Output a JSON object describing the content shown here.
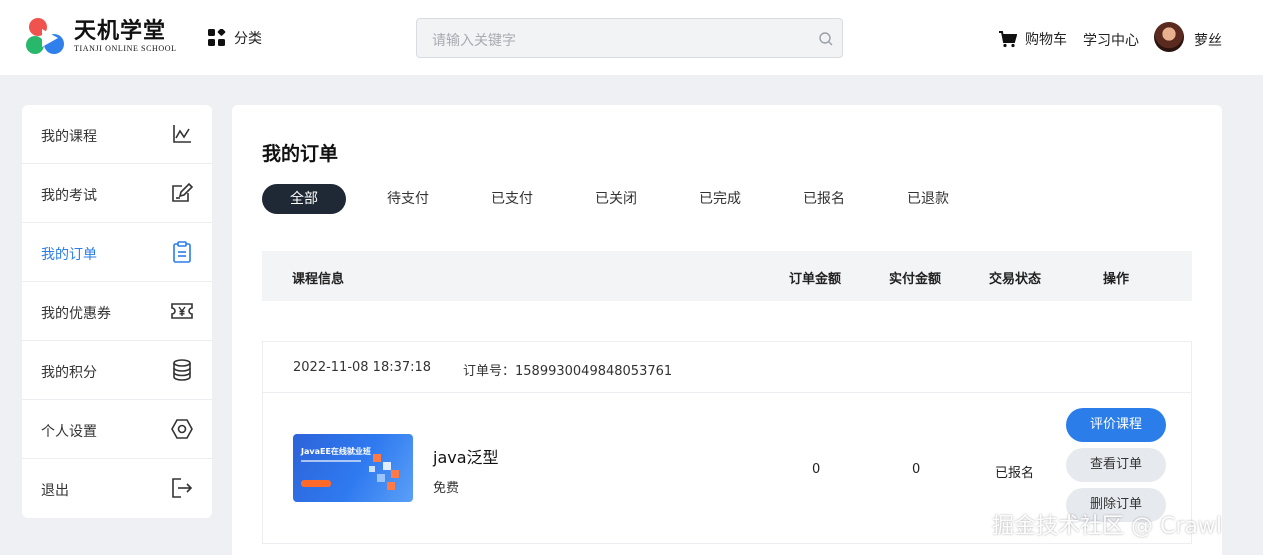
{
  "header": {
    "logo_cn": "天机学堂",
    "logo_en": "TIANJI ONLINE SCHOOL",
    "category_label": "分类",
    "search_placeholder": "请输入关键字",
    "cart_label": "购物车",
    "learning_center_label": "学习中心",
    "username": "萝丝"
  },
  "sidebar": {
    "items": [
      {
        "label": "我的课程",
        "icon": "chart-icon",
        "active": false
      },
      {
        "label": "我的考试",
        "icon": "edit-icon",
        "active": false
      },
      {
        "label": "我的订单",
        "icon": "clipboard-icon",
        "active": true
      },
      {
        "label": "我的优惠券",
        "icon": "coupon-icon",
        "active": false
      },
      {
        "label": "我的积分",
        "icon": "database-icon",
        "active": false
      },
      {
        "label": "个人设置",
        "icon": "hexagon-settings-icon",
        "active": false
      },
      {
        "label": "退出",
        "icon": "logout-icon",
        "active": false
      }
    ]
  },
  "main": {
    "title": "我的订单",
    "tabs": [
      "全部",
      "待支付",
      "已支付",
      "已关闭",
      "已完成",
      "已报名",
      "已退款"
    ],
    "active_tab": 0,
    "columns": [
      "课程信息",
      "订单金额",
      "实付金额",
      "交易状态",
      "操作"
    ]
  },
  "order": {
    "time": "2022-11-08 18:37:18",
    "number_label": "订单号：",
    "number": "1589930049848053761",
    "thumb_title": "JavaEE在线就业班",
    "course_name": "java泛型",
    "course_tag": "免费",
    "order_amount": "0",
    "paid_amount": "0",
    "status": "已报名",
    "actions": [
      "评价课程",
      "查看订单",
      "删除订单"
    ]
  },
  "watermark": "掘金技术社区 @ Crawl",
  "colors": {
    "accent": "#2b7de9",
    "tab_active_bg": "#1f2835",
    "page_bg": "#eef0f3"
  }
}
